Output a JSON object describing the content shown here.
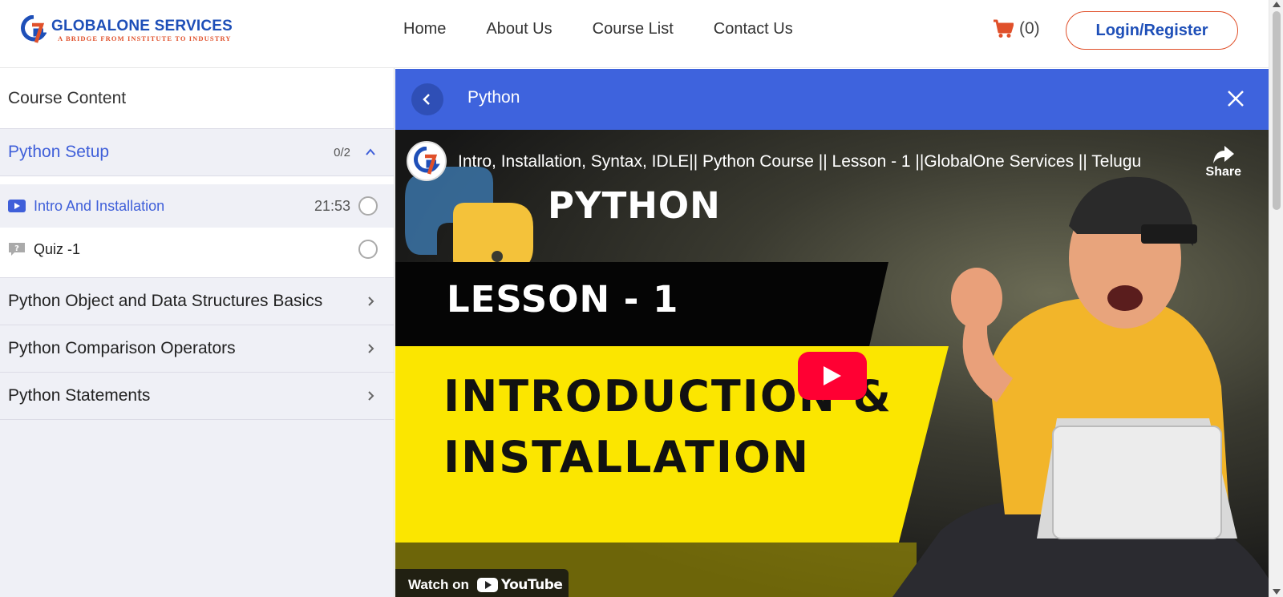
{
  "brand": {
    "name": "GLOBALONE SERVICES",
    "tagline": "A BRIDGE FROM INSTITUTE TO INDUSTRY",
    "primary_color": "#1e4fb8",
    "accent_color": "#e0502a"
  },
  "nav": {
    "items": [
      "Home",
      "About Us",
      "Course List",
      "Contact Us"
    ]
  },
  "cart": {
    "count_label": "(0)",
    "icon": "cart-icon"
  },
  "login_label": "Login/Register",
  "sidebar": {
    "title": "Course Content",
    "sections": [
      {
        "title": "Python Setup",
        "count": "0/2",
        "expanded": true,
        "lessons": [
          {
            "title": "Intro And Installation",
            "duration": "21:53",
            "icon": "video-icon",
            "current": true
          },
          {
            "title": "Quiz -1",
            "duration": "",
            "icon": "quiz-icon",
            "current": false
          }
        ]
      },
      {
        "title": "Python Object and Data Structures Basics",
        "expanded": false
      },
      {
        "title": "Python Comparison Operators",
        "expanded": false
      },
      {
        "title": "Python Statements",
        "expanded": false
      }
    ]
  },
  "player": {
    "title": "Python",
    "bar_color": "#3e63dd"
  },
  "video": {
    "title": "Intro, Installation, Syntax, IDLE|| Python Course || Lesson - 1 ||GlobalOne Services || Telugu",
    "share_label": "Share",
    "thumb_python": "PYTHON",
    "thumb_lesson": "LESSON - 1",
    "thumb_intro_line1": "INTRODUCTION &",
    "thumb_intro_line2": "INSTALLATION",
    "watch_on_label": "Watch on",
    "youtube_label": "YouTube"
  }
}
